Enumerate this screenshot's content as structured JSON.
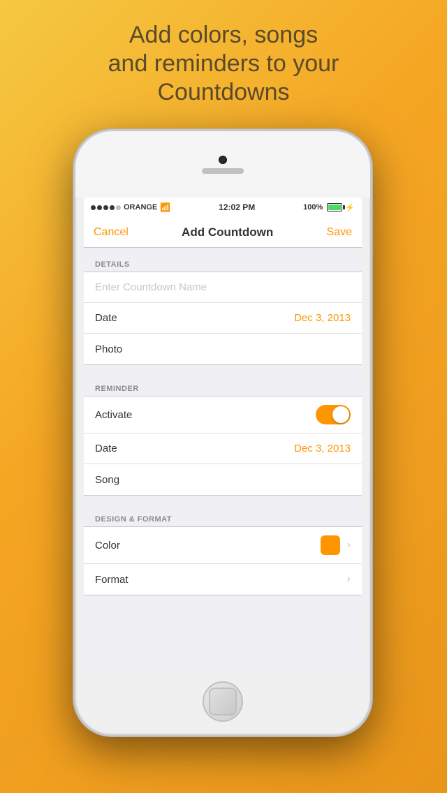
{
  "background": {
    "color": "#F5A623"
  },
  "header": {
    "line1": "Add colors, songs",
    "line2": "and reminders to your",
    "line3": "Countdowns"
  },
  "status_bar": {
    "carrier": "ORANGE",
    "signal_bars": 4,
    "wifi": true,
    "time": "12:02 PM",
    "battery_percent": "100%",
    "battery_charging": true
  },
  "nav_bar": {
    "cancel_label": "Cancel",
    "title": "Add Countdown",
    "save_label": "Save"
  },
  "sections": [
    {
      "id": "details",
      "header": "DETAILS",
      "rows": [
        {
          "id": "countdown-name",
          "type": "input",
          "placeholder": "Enter Countdown Name",
          "value": ""
        },
        {
          "id": "date",
          "type": "value",
          "label": "Date",
          "value": "Dec 3, 2013"
        },
        {
          "id": "photo",
          "type": "simple",
          "label": "Photo"
        }
      ]
    },
    {
      "id": "reminder",
      "header": "REMINDER",
      "rows": [
        {
          "id": "activate",
          "type": "toggle",
          "label": "Activate",
          "enabled": true
        },
        {
          "id": "reminder-date",
          "type": "value",
          "label": "Date",
          "value": "Dec 3, 2013"
        },
        {
          "id": "song",
          "type": "simple",
          "label": "Song"
        }
      ]
    },
    {
      "id": "design",
      "header": "DESIGN & FORMAT",
      "rows": [
        {
          "id": "color",
          "type": "color",
          "label": "Color",
          "color_value": "#FF9500"
        },
        {
          "id": "format",
          "type": "chevron",
          "label": "Format"
        }
      ]
    }
  ],
  "accent_color": "#FF9500",
  "icons": {
    "chevron": "›",
    "toggle_on": true
  }
}
